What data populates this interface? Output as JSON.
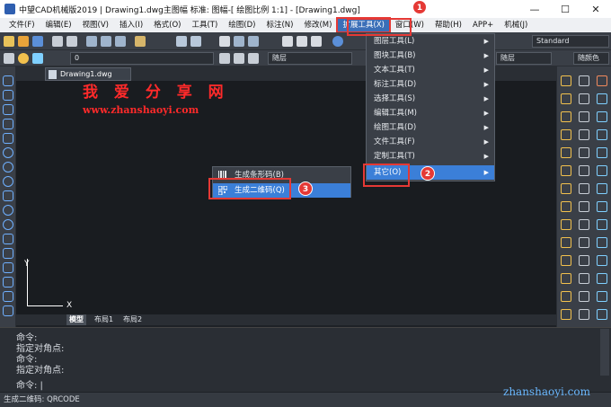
{
  "window": {
    "title": "中望CAD机械版2019 | Drawing1.dwg主图幅  标准: 图幅-[ 绘图比例 1:1] - [Drawing1.dwg]",
    "minimize": "—",
    "maximize": "☐",
    "close": "✕"
  },
  "menu": [
    "文件(F)",
    "编辑(E)",
    "视图(V)",
    "插入(I)",
    "格式(O)",
    "工具(T)",
    "绘图(D)",
    "标注(N)",
    "修改(M)",
    "扩展工具(X)",
    "窗口(W)",
    "帮助(H)",
    "APP+",
    "机械(J)"
  ],
  "toolbar": {
    "layer_value": "0",
    "bylayer_1": "随层",
    "bylayer_2": "随层",
    "bylayer_color": "随颜色",
    "standard_style": "Standard"
  },
  "document": {
    "tab_label": "Drawing1.dwg"
  },
  "watermark": {
    "text": "我 爱 分 享 网",
    "url": "www.zhanshaoyi.com"
  },
  "ucs": {
    "x": "X",
    "y": "Y"
  },
  "layout_tabs": [
    "模型",
    "布局1",
    "布局2"
  ],
  "dropdown": {
    "items": [
      "图层工具(L)",
      "图块工具(B)",
      "文本工具(T)",
      "标注工具(D)",
      "选择工具(S)",
      "编辑工具(M)",
      "绘图工具(D)",
      "文件工具(F)",
      "定制工具(T)",
      "其它(O)"
    ]
  },
  "submenu": {
    "items": [
      "生成条形码(B)",
      "生成二维码(Q)"
    ]
  },
  "steps": [
    "1",
    "2",
    "3"
  ],
  "command": {
    "lines": [
      "命令:",
      "指定对角点:",
      "命令:",
      "指定对角点:"
    ],
    "prompt": "命令: |"
  },
  "status": {
    "text": "生成二维码: QRCODE"
  },
  "site_watermark": "zhanshaoyi.com",
  "colors": {
    "accent": "#3b7fd8",
    "highlight_box": "#e53935",
    "watermark": "#ff2a2a"
  }
}
